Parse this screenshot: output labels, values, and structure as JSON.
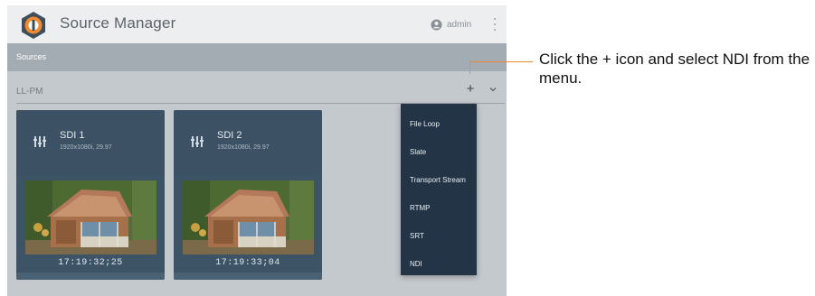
{
  "header": {
    "title": "Source Manager",
    "user": "admin"
  },
  "sources_bar": {
    "label": "Sources"
  },
  "filter": {
    "value": "LL-PM",
    "add_label": "+"
  },
  "cards": [
    {
      "name": "SDI 1",
      "format": "1920x1080i, 29.97",
      "timecode": "17:19:32;25"
    },
    {
      "name": "SDI 2",
      "format": "1920x1080i, 29.97",
      "timecode": "17:19:33;04"
    }
  ],
  "menu": {
    "items": [
      "File Loop",
      "Slate",
      "Transport Stream",
      "RTMP",
      "SRT",
      "NDI"
    ]
  },
  "callout": {
    "text": "Click the + icon and select NDI from the menu."
  },
  "colors": {
    "header_bg": "#eceef0",
    "sources_bar": "#a4acb3",
    "canvas": "#c4c9cd",
    "card": "#3d5466",
    "menu": "#223446",
    "callout_line": "#f08a2e"
  }
}
